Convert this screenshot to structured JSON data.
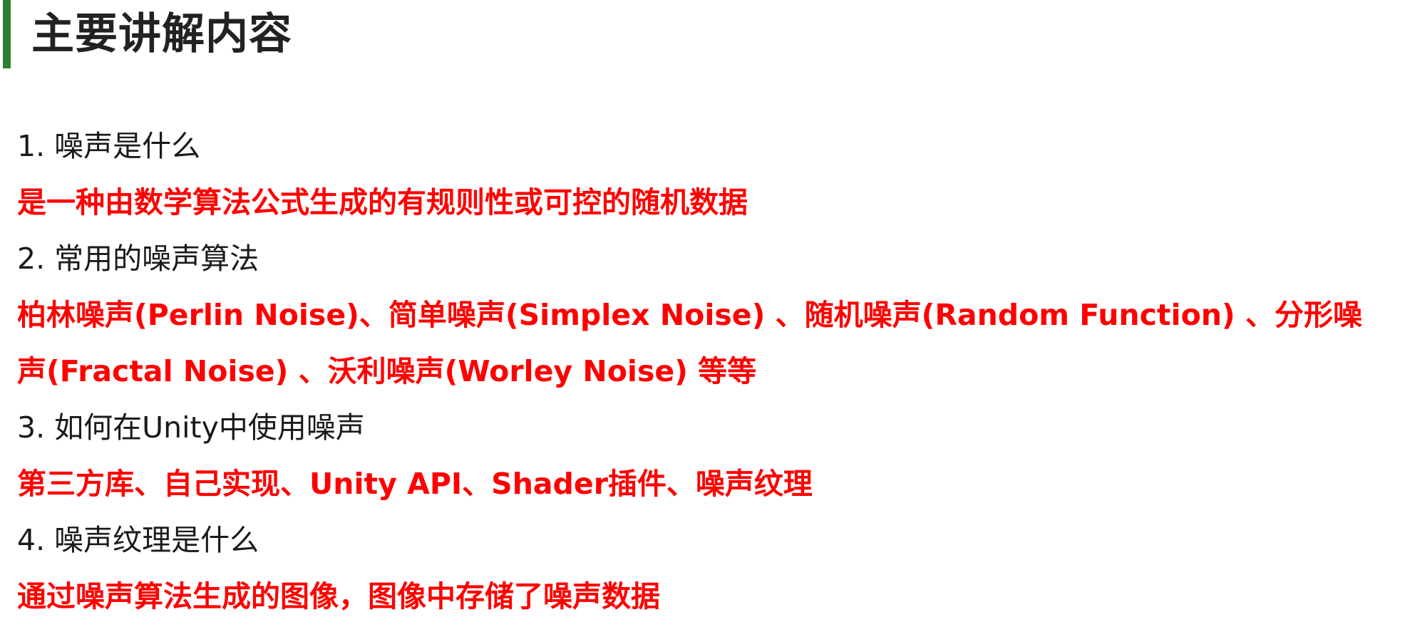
{
  "header": {
    "title": "主要讲解内容"
  },
  "items": [
    {
      "question": "1. 噪声是什么",
      "answer_lines": [
        "是一种由数学算法公式生成的有规则性或可控的随机数据"
      ]
    },
    {
      "question": "2. 常用的噪声算法",
      "answer_lines": [
        "柏林噪声(Perlin Noise)、简单噪声(Simplex Noise) 、随机噪声(Random Function) 、分形噪",
        "声(Fractal Noise) 、沃利噪声(Worley Noise) 等等"
      ]
    },
    {
      "question": "3. 如何在Unity中使用噪声",
      "answer_lines": [
        "第三方库、自己实现、Unity API、Shader插件、噪声纹理"
      ]
    },
    {
      "question": "4. 噪声纹理是什么",
      "answer_lines": [
        "通过噪声算法生成的图像，图像中存储了噪声数据"
      ]
    }
  ],
  "colors": {
    "accent_bar": "#2e7d32",
    "answer_text": "#ff0000",
    "question_text": "#1a1a1a"
  }
}
